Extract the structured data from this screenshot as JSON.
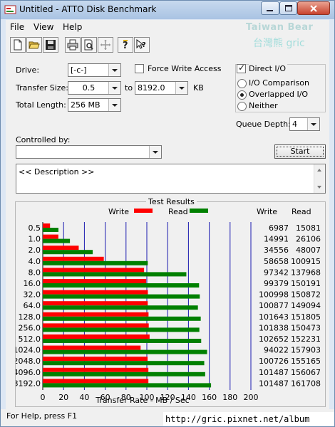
{
  "window": {
    "title": "Untitled - ATTO Disk Benchmark"
  },
  "menu": {
    "items": [
      "File",
      "View",
      "Help"
    ]
  },
  "watermark": {
    "line1": "Taiwan Bear",
    "line2": "台灣熊 gric"
  },
  "toolbar": {
    "icons": [
      "new-document-icon",
      "open-folder-icon",
      "save-icon",
      "print-icon",
      "print-preview-icon",
      "move-icon",
      "help-icon",
      "context-help-icon"
    ]
  },
  "settings": {
    "drive_label": "Drive:",
    "drive_value": "[-c-]",
    "force_write_label": "Force Write Access",
    "force_write_checked": false,
    "direct_io_label": "Direct I/O",
    "direct_io_checked": true,
    "transfer_size_label": "Transfer Size:",
    "transfer_from": "0.5",
    "to_label": "to",
    "transfer_to": "8192.0",
    "kb_label": "KB",
    "total_length_label": "Total Length:",
    "total_length_value": "256 MB",
    "io_modes": [
      "I/O Comparison",
      "Overlapped I/O",
      "Neither"
    ],
    "io_mode_selected": 1,
    "queue_depth_label": "Queue Depth:",
    "queue_depth_value": "4",
    "controlled_by_label": "Controlled by:",
    "controlled_by_value": "",
    "start_label": "Start",
    "description": "<< Description >>"
  },
  "results": {
    "title": "Test Results",
    "write_col": "Write",
    "read_col": "Read"
  },
  "status": {
    "help_text": "For Help, press F1",
    "url": "http://gric.pixnet.net/album"
  },
  "colors": {
    "write": "#ff0000",
    "read": "#008000",
    "gridline": "#1a1ab0"
  },
  "chart_data": {
    "type": "bar",
    "orientation": "horizontal",
    "title": "Test Results",
    "xlabel": "Transfer Rate - MB / Sec",
    "xlim": [
      0,
      200
    ],
    "xticks": [
      0,
      20,
      40,
      60,
      80,
      100,
      120,
      140,
      160,
      180,
      200
    ],
    "grid": true,
    "legend_position": "top",
    "categories": [
      "0.5",
      "1.0",
      "2.0",
      "4.0",
      "8.0",
      "16.0",
      "32.0",
      "64.0",
      "128.0",
      "256.0",
      "512.0",
      "1024.0",
      "2048.0",
      "4096.0",
      "8192.0"
    ],
    "series": [
      {
        "name": "Write",
        "color": "#ff0000",
        "values": [
          6987,
          14991,
          34556,
          58658,
          97342,
          99379,
          100998,
          100877,
          101643,
          101838,
          102652,
          94022,
          100726,
          101487,
          101487
        ]
      },
      {
        "name": "Read",
        "color": "#008000",
        "values": [
          15081,
          26106,
          48007,
          100915,
          137968,
          150191,
          150872,
          149094,
          151805,
          150473,
          152231,
          157903,
          155165,
          156067,
          161708
        ]
      }
    ]
  }
}
